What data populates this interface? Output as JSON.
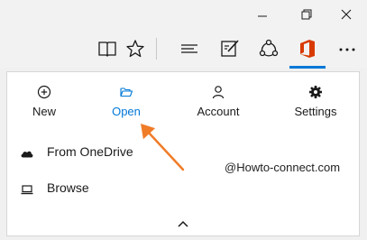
{
  "hub": {
    "items": [
      {
        "label": "New",
        "icon": "plus-circle-icon"
      },
      {
        "label": "Open",
        "icon": "folder-open-icon",
        "active": true
      },
      {
        "label": "Account",
        "icon": "person-icon"
      },
      {
        "label": "Settings",
        "icon": "gear-icon"
      }
    ]
  },
  "list": {
    "from_onedrive": "From OneDrive",
    "browse": "Browse"
  },
  "watermark": "@Howto-connect.com",
  "colors": {
    "accent": "#0078d7",
    "office": "#d83b01",
    "annotation_arrow": "#f07c28"
  },
  "toolbar_icons": [
    "reading-view-icon",
    "favorite-star-icon",
    "hub-icon",
    "web-note-icon",
    "share-icon",
    "office-icon",
    "more-icon"
  ],
  "window_controls": [
    "minimize-icon",
    "restore-icon",
    "close-icon"
  ]
}
